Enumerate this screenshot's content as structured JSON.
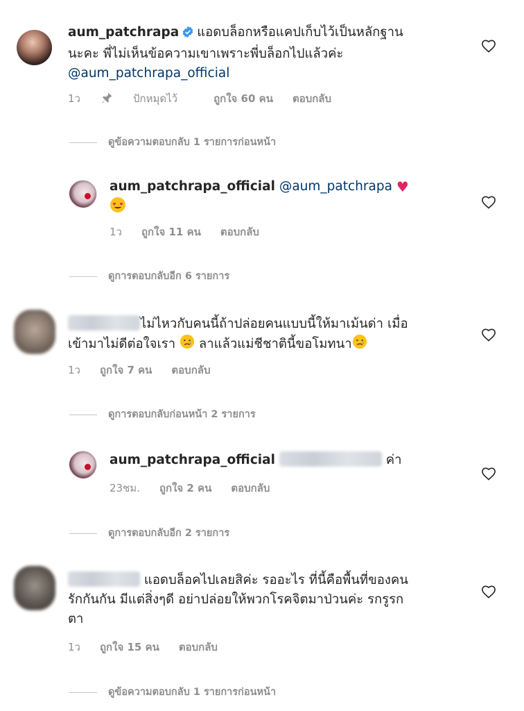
{
  "comments": [
    {
      "username": "aum_patchrapa",
      "verified": true,
      "text_line1": "แอดบล็อกหรือแคปเก็บไว้เป็นหลักฐาน",
      "text_line2": "นะคะ  พี่ไม่เห็นข้อความเขาเพราะพี่บล็อกไปแล้วค่ะ",
      "mention": "@aum_patchrapa_official",
      "time": "1ว",
      "pinned_label": "ปักหมุดไว้",
      "likes": "ถูกใจ 60 คน",
      "reply_label": "ตอบกลับ"
    },
    {
      "username": "aum_patchrapa_official",
      "mention": "@aum_patchrapa",
      "time": "1ว",
      "likes": "ถูกใจ 11 คน",
      "reply_label": "ตอบกลับ"
    },
    {
      "text_line1": "ไม่ไหวกับคนนี้ถ้าปล่อยคนแบบนี้ให้มาเม้นด่า เมื่อ",
      "text_line2a": "เข้ามาไม่ดีต่อใจเรา",
      "text_line2b": "ลาแล้วแม่ชีชาตินี้ขอโมทนา",
      "time": "1ว",
      "likes": "ถูกใจ 7 คน",
      "reply_label": "ตอบกลับ"
    },
    {
      "username": "aum_patchrapa_official",
      "text_suffix": "ค่า",
      "time": "23ชม.",
      "likes": "ถูกใจ 2 คน",
      "reply_label": "ตอบกลับ"
    },
    {
      "text_line1": "แอดบล็อคไปเลยสิค่ะ รออะไร  ที่นี้คือพื้นที่ของคน",
      "text_line2": "รักกันกัน มีแต่สิ่งๆดี อย่าปล่อยให้พวกโรคจิตมาป่วนค่ะ รกรูรก",
      "text_line3": "ตา",
      "time": "1ว",
      "likes": "ถูกใจ 15 คน",
      "reply_label": "ตอบกลับ"
    }
  ],
  "view_replies": {
    "previous_1": "ดูข้อความตอบกลับ 1 รายการก่อนหน้า",
    "more_6": "ดูการตอบกลับอีก 6 รายการ",
    "previous_2": "ดูการตอบกลับก่อนหน้า 2 รายการ",
    "more_2": "ดูการตอบกลับอีก 2 รายการ",
    "previous_1b": "ดูข้อความตอบกลับ 1 รายการก่อนหน้า"
  },
  "icons": {
    "like": "heart-outline-icon",
    "verified": "verified-badge-icon",
    "pin": "pin-icon"
  },
  "colors": {
    "text": "#262626",
    "meta": "#8e8e8e",
    "mention": "#00376b",
    "verified": "#3897f0"
  }
}
